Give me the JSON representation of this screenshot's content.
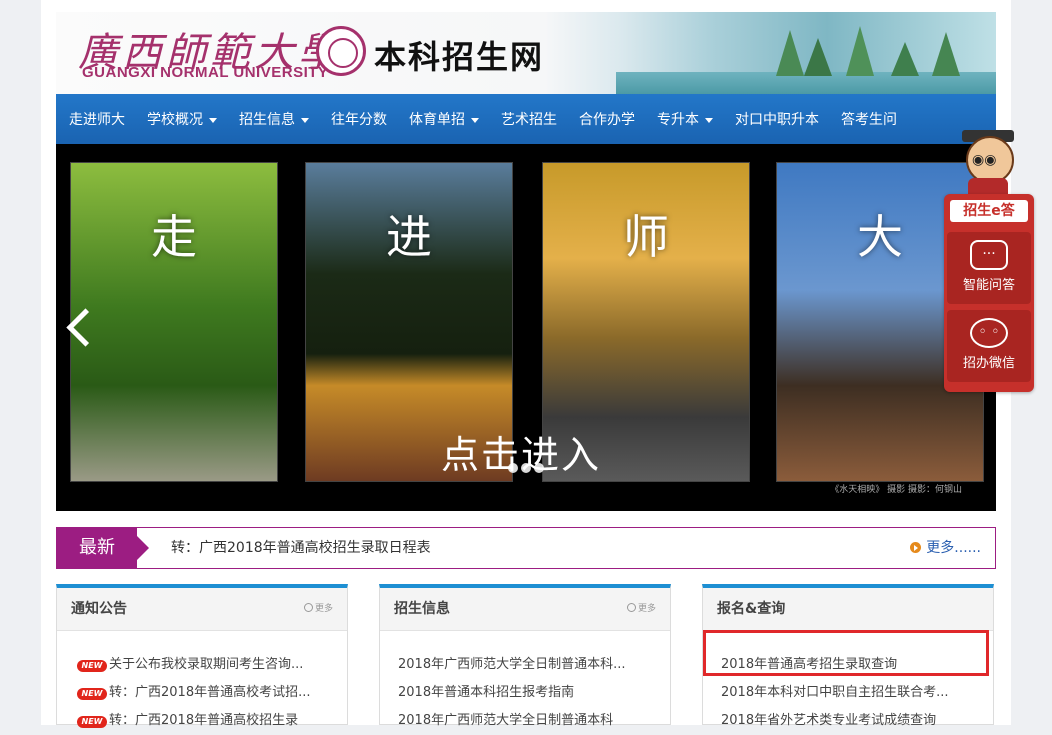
{
  "banner": {
    "calligraphy": "廣西師範大學",
    "english_name": "GUANGXI NORMAL UNIVERSITY",
    "site_name": "本科招生网"
  },
  "nav": {
    "items": [
      {
        "label": "走进师大",
        "dropdown": false
      },
      {
        "label": "学校概况",
        "dropdown": true
      },
      {
        "label": "招生信息",
        "dropdown": true
      },
      {
        "label": "往年分数",
        "dropdown": false
      },
      {
        "label": "体育单招",
        "dropdown": true
      },
      {
        "label": "艺术招生",
        "dropdown": false
      },
      {
        "label": "合作办学",
        "dropdown": false
      },
      {
        "label": "专升本",
        "dropdown": true
      },
      {
        "label": "对口中职升本",
        "dropdown": false
      },
      {
        "label": "答考生问",
        "dropdown": false
      }
    ]
  },
  "slider": {
    "panels": [
      "走",
      "进",
      "师",
      "大"
    ],
    "enter_text": "点击进入",
    "caption": "《水天相映》 摄影  摄影：何钢山",
    "dots": 3
  },
  "widget": {
    "title": "招生e答",
    "items": [
      {
        "label": "智能问答",
        "icon": "chat-bubble-icon"
      },
      {
        "label": "招办微信",
        "icon": "wechat-icon"
      }
    ]
  },
  "latest": {
    "tag": "最新",
    "news": "转：广西2018年普通高校招生录取日程表",
    "more": "更多......"
  },
  "boxes": [
    {
      "title": "通知公告",
      "more": "更多",
      "items": [
        {
          "text": "关于公布我校录取期间考生咨询...",
          "new": true
        },
        {
          "text": "转：广西2018年普通高校考试招...",
          "new": true
        },
        {
          "text": "转：广西2018年普通高校招生录",
          "new": true
        }
      ]
    },
    {
      "title": "招生信息",
      "more": "更多",
      "items": [
        {
          "text": "2018年广西师范大学全日制普通本科..."
        },
        {
          "text": "2018年普通本科招生报考指南"
        },
        {
          "text": "2018年广西师范大学全日制普通本科"
        }
      ]
    },
    {
      "title": "报名&查询",
      "more": "",
      "items": [
        {
          "text": "2018年普通高考招生录取查询"
        },
        {
          "text": "2018年本科对口中职自主招生联合考..."
        },
        {
          "text": "2018年省外艺术类专业考试成绩查询"
        }
      ]
    }
  ],
  "colors": {
    "nav_blue": "#1a63b1",
    "brand_purple": "#9c1d82",
    "box_top_blue": "#1d8fd3",
    "widget_red": "#c6302b",
    "highlight_red": "#e0282a"
  }
}
